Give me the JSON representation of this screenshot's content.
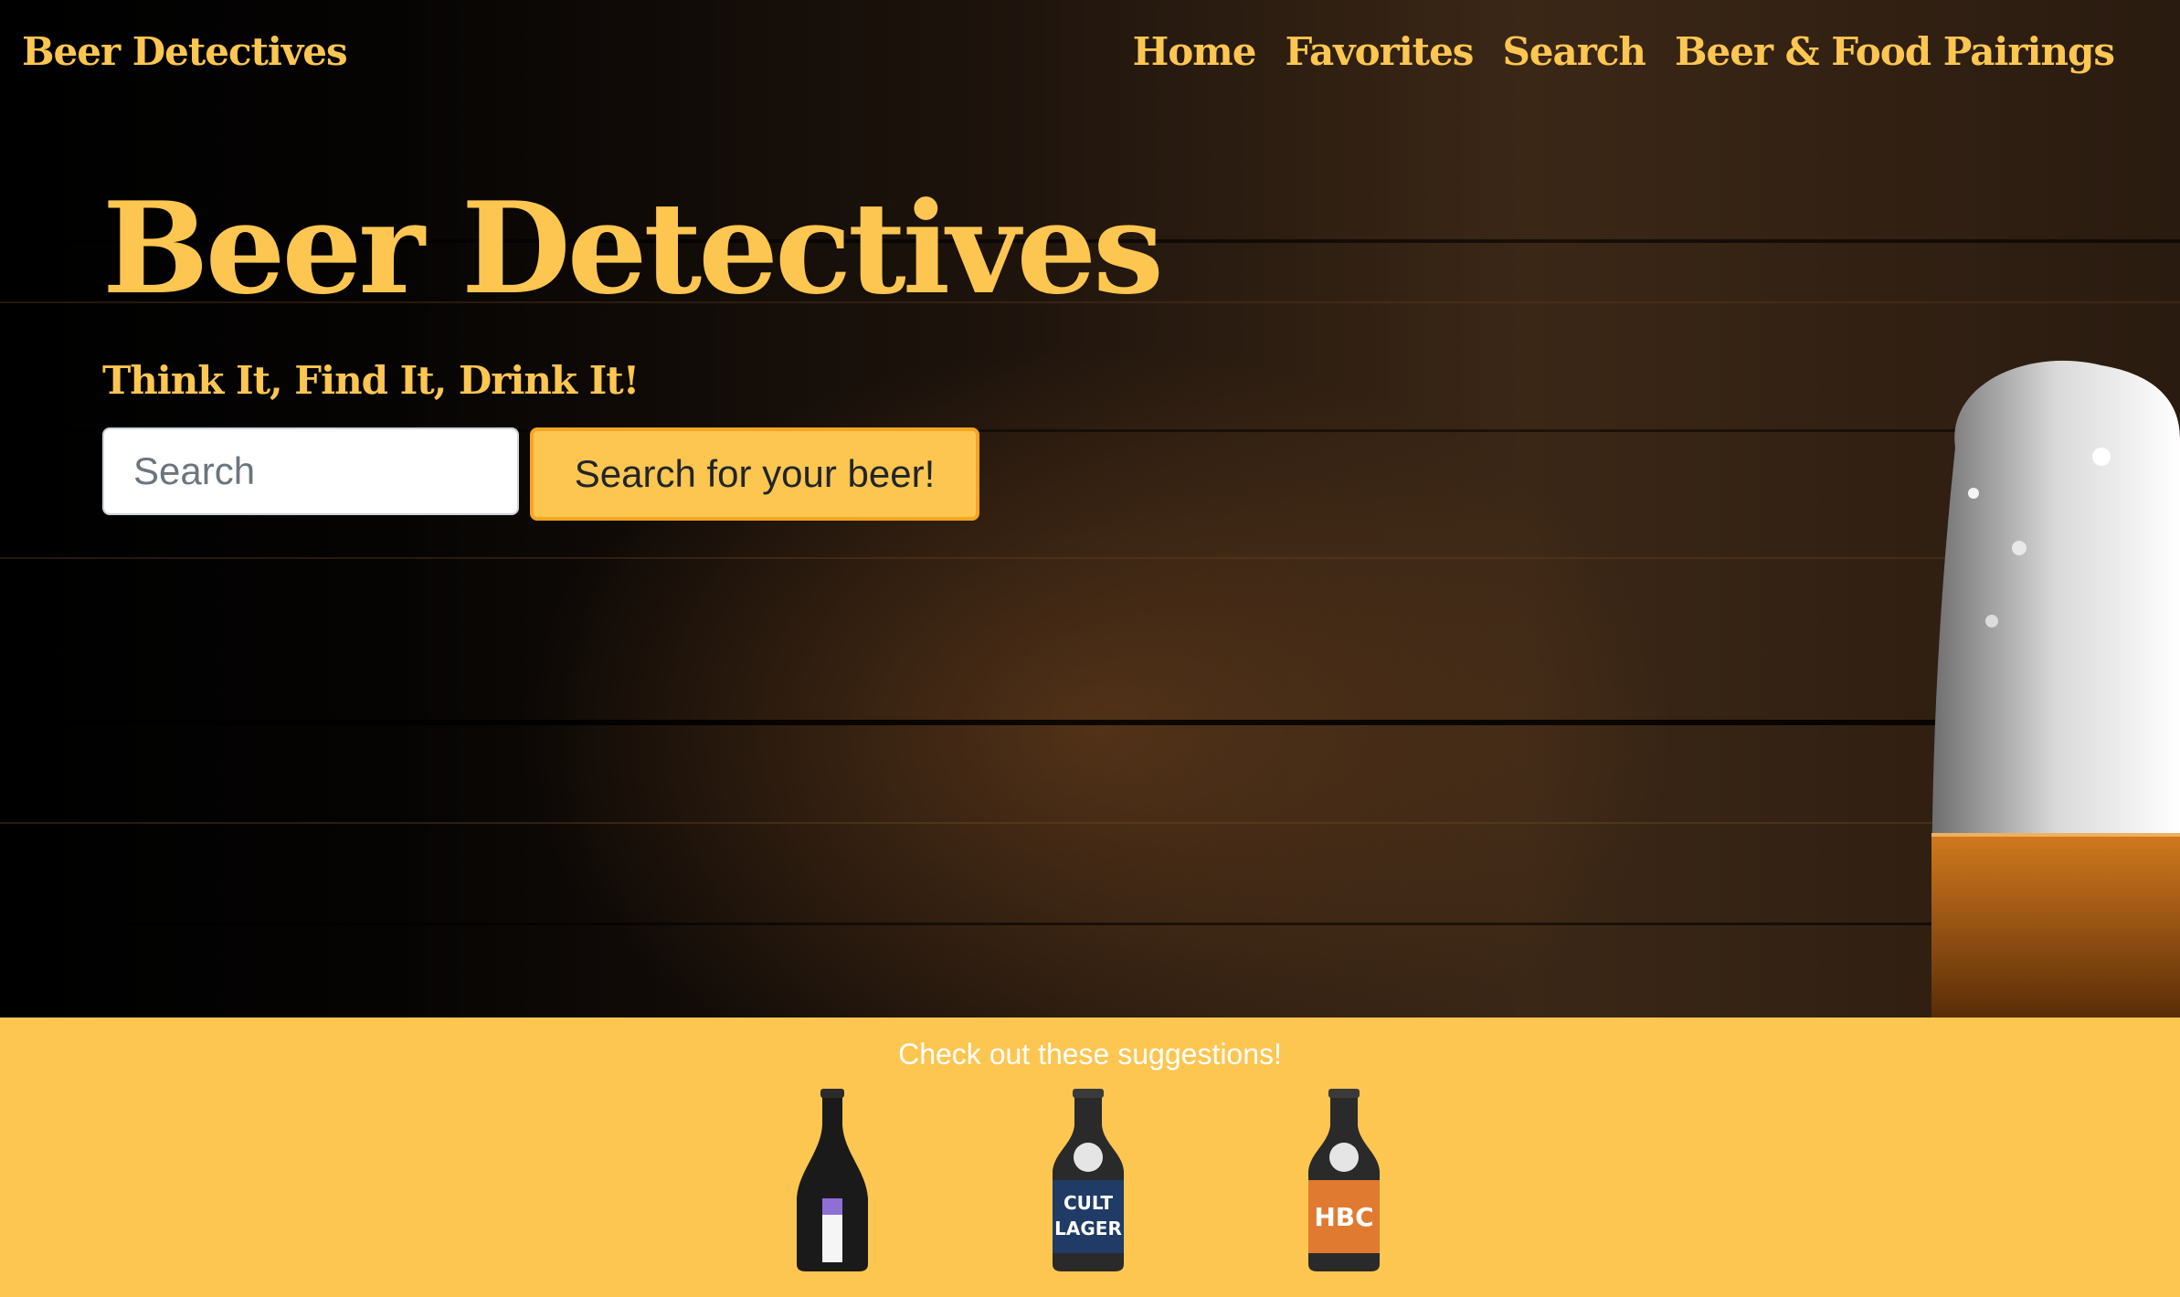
{
  "navbar": {
    "brand": "Beer Detectives",
    "links": [
      "Home",
      "Favorites",
      "Search",
      "Beer & Food Pairings"
    ]
  },
  "hero": {
    "title": "Beer Detectives",
    "tagline": "Think It, Find It, Drink It!",
    "search_placeholder": "Search",
    "search_button": "Search for your beer!"
  },
  "suggestions": {
    "title": "Check out these suggestions!",
    "items": [
      {
        "name": "dark-bottle",
        "label_color": "#8f6ed5"
      },
      {
        "name": "cult-lager-bottle",
        "label_text": "CULT LAGER",
        "label_color": "#1f3b66"
      },
      {
        "name": "hbc-bottle",
        "label_text": "HBC",
        "label_color": "#e07a30"
      }
    ]
  },
  "colors": {
    "accent": "#FCC651",
    "button_border": "#F5A623",
    "wood_dark": "#000000",
    "wood_light": "#3b2716"
  }
}
